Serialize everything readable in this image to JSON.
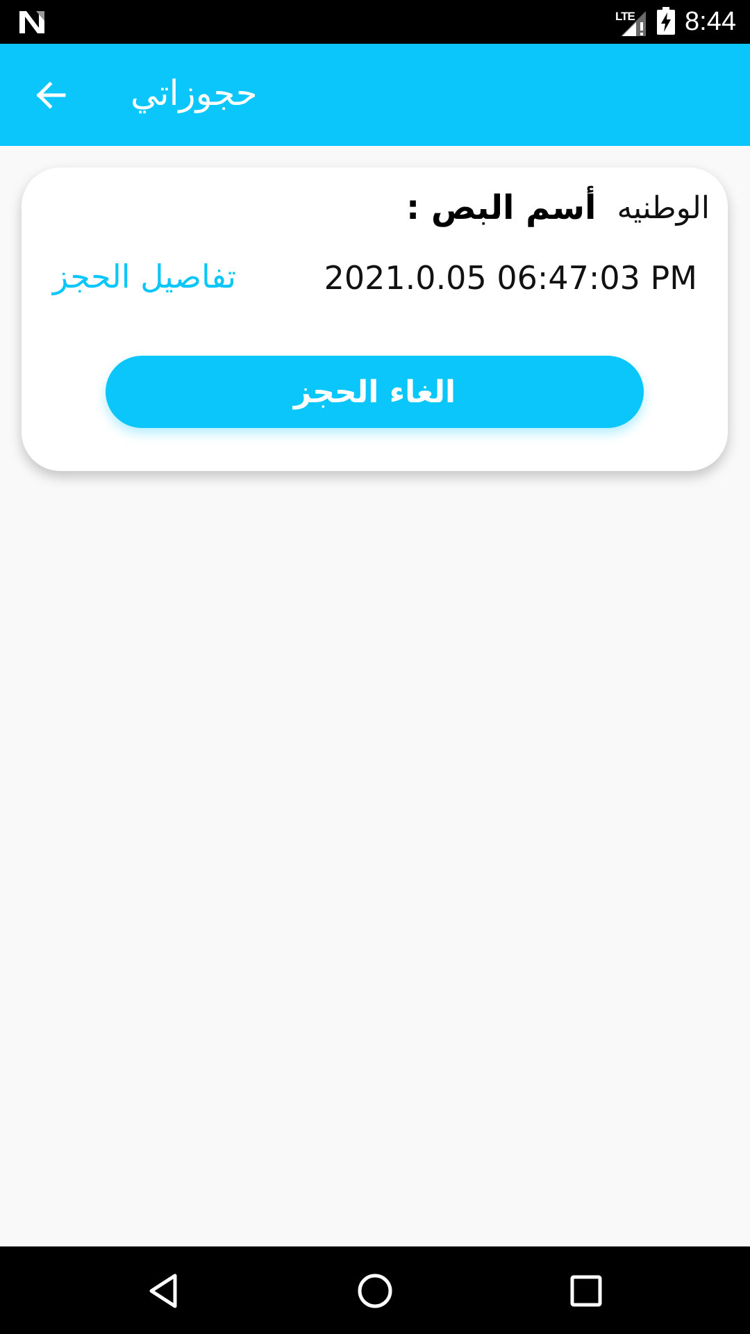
{
  "status_bar": {
    "network_label": "LTE",
    "clock": "8:44",
    "icons": [
      "n-logo-icon",
      "signal-icon",
      "battery-charging-icon"
    ]
  },
  "app_bar": {
    "title": "حجوزاتي",
    "back_icon": "arrow-back-icon",
    "background": "#0ac6fa"
  },
  "booking": {
    "bus_label": "أسم البص :",
    "bus_name": "الوطنيه",
    "datetime": "2021.0.05 06:47:03 PM",
    "details_link": "تفاصيل الحجز",
    "cancel_button": "الغاء الحجز"
  },
  "nav_bar": {
    "icons": [
      "back-triangle-icon",
      "home-circle-icon",
      "recents-square-icon"
    ]
  },
  "colors": {
    "accent": "#0ac6fa",
    "background": "#f9f9f9",
    "card": "#ffffff"
  }
}
